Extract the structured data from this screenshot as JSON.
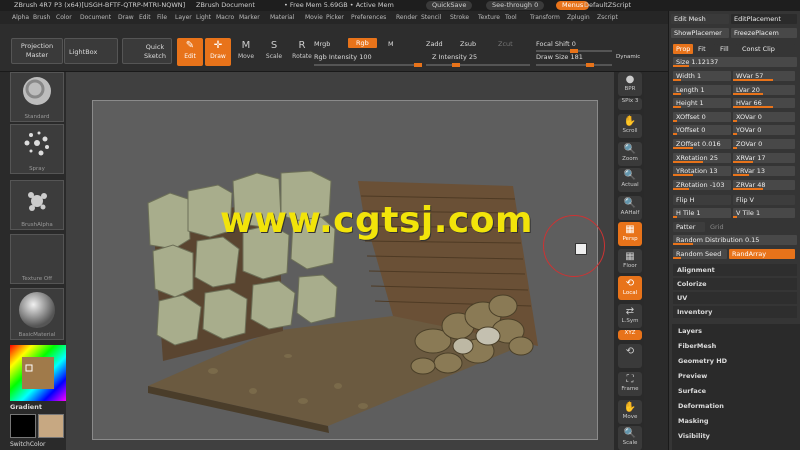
{
  "titlebar": {
    "title": "ZBrush 4R7 P3 (x64)[USGH-BFTF-QTRP-MTRI-NQWN]",
    "doc": "ZBrush Document",
    "mem": "• Free Mem 5.69GB • Active Mem",
    "quicksave": "QuickSave",
    "seethrough": "See-through  0",
    "menus": "Menus",
    "script": "DefaultZScript"
  },
  "menubar": [
    "Alpha",
    "Brush",
    "Color",
    "Document",
    "Draw",
    "Edit",
    "File",
    "Layer",
    "Light",
    "Macro",
    "Marker",
    "Material",
    "Movie",
    "Picker",
    "Preferences",
    "Render",
    "Stencil",
    "Stroke",
    "Texture",
    "Tool",
    "Transform",
    "Zplugin",
    "Zscript"
  ],
  "toolbar": {
    "projection": "Projection Master",
    "lightbox": "LightBox",
    "quicksketch": "Quick Sketch",
    "tools": [
      {
        "label": "Edit",
        "icon": "✎",
        "active": true
      },
      {
        "label": "Draw",
        "icon": "✛",
        "active": true
      },
      {
        "label": "Move",
        "icon": "M",
        "active": false
      },
      {
        "label": "Scale",
        "icon": "S",
        "active": false
      },
      {
        "label": "Rotate",
        "icon": "R",
        "active": false
      }
    ],
    "mrgb": "Mrgb",
    "rgb": "Rgb",
    "m": "M",
    "rgb_intensity": "Rgb Intensity 100",
    "zadd": "Zadd",
    "zsub": "Zsub",
    "zcut": "Zcut",
    "z_intensity": "Z Intensity 25",
    "focal_shift": "Focal Shift 0",
    "draw_size": "Draw Size 181",
    "dynamic": "Dynamic"
  },
  "leftshelf": {
    "brush": "Standard",
    "stroke": "Spray",
    "alpha": "BrushAlpha",
    "texture": "Texture Off",
    "material": "BasicMaterial",
    "gradient": "Gradient",
    "switchcolor": "SwitchColor"
  },
  "rightshelf": [
    {
      "label": "BPR",
      "icon": "●"
    },
    {
      "label": "SPix 3",
      "icon": ""
    },
    {
      "label": "Scroll",
      "icon": "✋"
    },
    {
      "label": "Zoom",
      "icon": "🔍"
    },
    {
      "label": "Actual",
      "icon": "🔍"
    },
    {
      "label": "AAHalf",
      "icon": "🔍"
    },
    {
      "label": "Persp",
      "icon": "▦"
    },
    {
      "label": "Floor",
      "icon": "▦"
    },
    {
      "label": "Local",
      "icon": "⟲"
    },
    {
      "label": "L.Sym",
      "icon": "⇄"
    },
    {
      "label": "XYZ",
      "icon": ""
    },
    {
      "label": "",
      "icon": "⟲"
    },
    {
      "label": "Frame",
      "icon": "⛶"
    },
    {
      "label": "Move",
      "icon": "✋"
    },
    {
      "label": "Scale",
      "icon": "🔍"
    }
  ],
  "palette": {
    "editmesh": "Edit Mesh",
    "editplacement": "EditPlacement",
    "showplacement": "ShowPlacemer",
    "freezeplacement": "FreezePlacem",
    "prop": "Prop",
    "fit": "Fit",
    "fill": "Fill",
    "constclip": "Const Clip",
    "size": "Size 1.12137",
    "fields": [
      [
        "Width 1",
        "WVar 57"
      ],
      [
        "Length 1",
        "LVar 20"
      ],
      [
        "Height 1",
        "HVar 66"
      ],
      [
        "XOffset 0",
        "XOVar 0"
      ],
      [
        "YOffset 0",
        "YOVar 0"
      ],
      [
        "ZOffset 0.016",
        "ZOVar 0"
      ],
      [
        "XRotation 25",
        "XRVar 17"
      ],
      [
        "YRotation 13",
        "YRVar 13"
      ],
      [
        "ZRotation -103",
        "ZRVar 48"
      ]
    ],
    "flip_h": "Flip H",
    "flip_v": "Flip V",
    "h_tile": "H Tile 1",
    "v_tile": "V Tile 1",
    "pattern": "Patter",
    "grid": "Grid",
    "random_distribution": "Random Distribution 0.15",
    "random_seed": "Random Seed",
    "randarray": "RandArray",
    "sections": [
      "Alignment",
      "Colorize",
      "UV",
      "Inventory"
    ]
  },
  "subpalette": [
    "Layers",
    "FiberMesh",
    "Geometry HD",
    "Preview",
    "Surface",
    "Deformation",
    "Masking",
    "Visibility"
  ],
  "watermark": "www.cgtsj.com",
  "colors": {
    "accent": "#e8731a",
    "bg": "#2b2b2b",
    "panel": "#353535"
  }
}
